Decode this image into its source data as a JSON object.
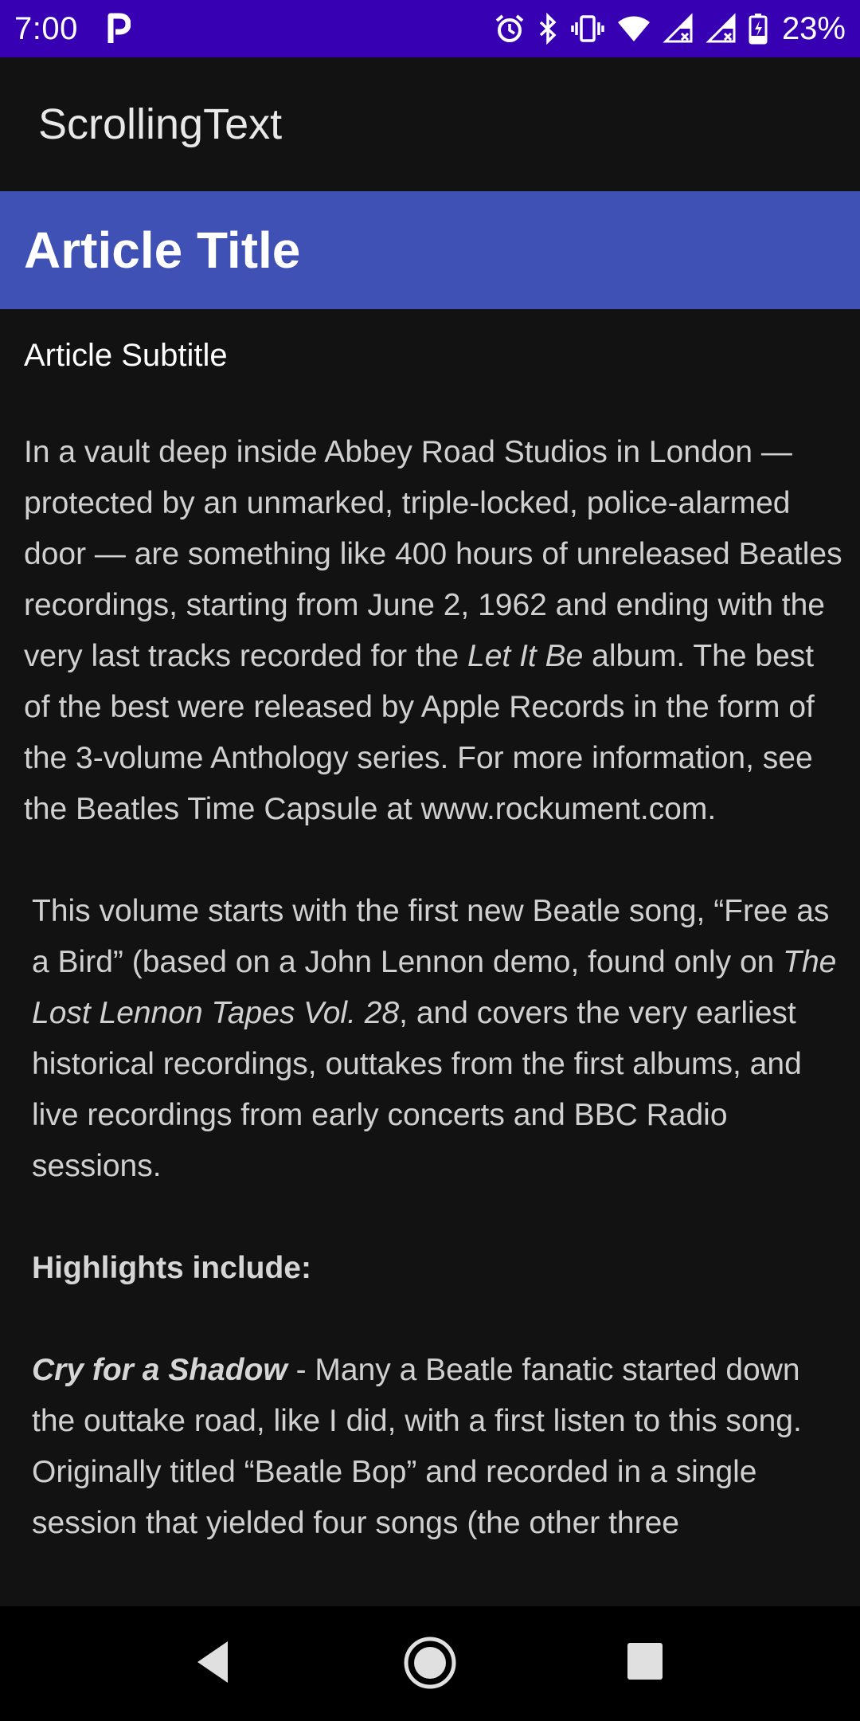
{
  "status_bar": {
    "time": "7:00",
    "battery_percent": "23%",
    "icons": [
      "parking-icon",
      "alarm-icon",
      "bluetooth-icon",
      "vibrate-icon",
      "wifi-icon",
      "signal-icon",
      "signal-icon-2",
      "battery-icon"
    ]
  },
  "app_bar": {
    "title": "ScrollingText"
  },
  "article": {
    "heading": "Article Title",
    "subtitle": "Article Subtitle",
    "p1_a": "In a vault deep inside Abbey Road Studios in London — protected by an unmarked, triple-locked, police-alarmed door — are something like 400 hours of unreleased Beatles recordings, starting from June 2, 1962 and ending with the very last tracks recorded for the ",
    "p1_em": "Let It Be",
    "p1_b": " album. The best of the best were released by Apple Records in the form of the 3-volume Anthology series. For more information, see the Beatles Time Capsule at www.rockument.com.",
    "p2_a": "This volume starts with the first new Beatle song, “Free as a Bird” (based on a John Lennon demo, found only on ",
    "p2_em": "The Lost Lennon Tapes Vol. 28",
    "p2_b": ", and covers the very earliest historical recordings, outtakes from the first albums, and live recordings from early concerts and BBC Radio sessions.",
    "highlights_label": "Highlights include:",
    "p3_strong": "Cry for a Shadow",
    "p3_b": " - Many a Beatle fanatic started down the outtake road, like I did, with a first listen to this song. Originally titled “Beatle Bop” and recorded in a single session that yielded four songs (the other three"
  },
  "nav_bar": {
    "icons": [
      "back-icon",
      "home-icon",
      "recents-icon"
    ]
  },
  "colors": {
    "status_bar": "#3700b3",
    "heading_band": "#3f51b5",
    "background": "#121212"
  }
}
